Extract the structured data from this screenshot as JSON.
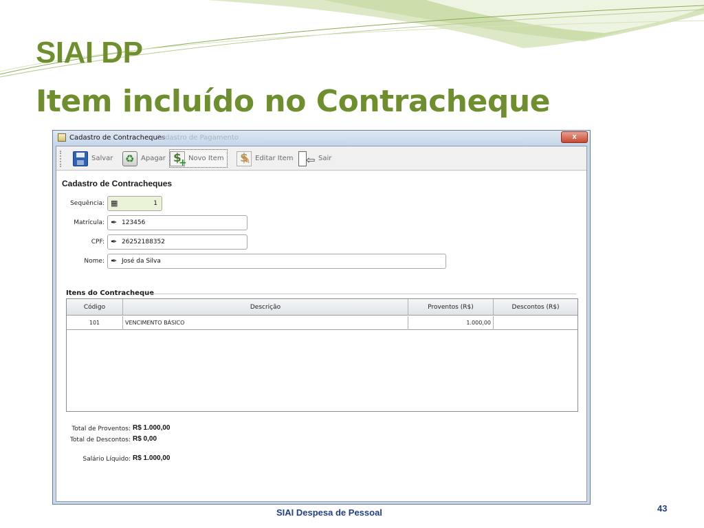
{
  "slide": {
    "title_line1": "SIAI DP",
    "title_line2": "Item incluído no Contracheque",
    "footer": "SIAI Despesa de Pessoal",
    "page_number": "43",
    "accent_color": "#6f8f2e",
    "footer_color": "#1f3f8a"
  },
  "window": {
    "title": "Cadastro de Contracheques",
    "title_ghost": "Cadastro de Pagamento",
    "close_label": "x"
  },
  "toolbar": {
    "save_label": "Salvar",
    "delete_label": "Apagar",
    "new_item_label": "Novo Item",
    "edit_item_label": "Editar Item",
    "exit_label": "Sair"
  },
  "form": {
    "title": "Cadastro de Contracheques",
    "sequencia_label": "Sequência:",
    "sequencia_value": "1",
    "matricula_label": "Matrícula:",
    "matricula_value": "123456",
    "cpf_label": "CPF:",
    "cpf_value": "26252188352",
    "nome_label": "Nome:",
    "nome_value": "José da Silva"
  },
  "items": {
    "section_title": "Itens do Contracheque",
    "columns": [
      "Código",
      "Descrição",
      "Proventos (R$)",
      "Descontos (R$)"
    ],
    "rows": [
      {
        "codigo": "101",
        "descricao": "VENCIMENTO BÁSICO",
        "proventos": "1.000,00",
        "descontos": ""
      }
    ]
  },
  "totals": {
    "proventos_label": "Total de Proventos:",
    "proventos_value": "R$ 1.000,00",
    "descontos_label": "Total de Descontos:",
    "descontos_value": "R$ 0,00",
    "liquido_label": "Salário Líquido:",
    "liquido_value": "R$ 1.000,00"
  }
}
